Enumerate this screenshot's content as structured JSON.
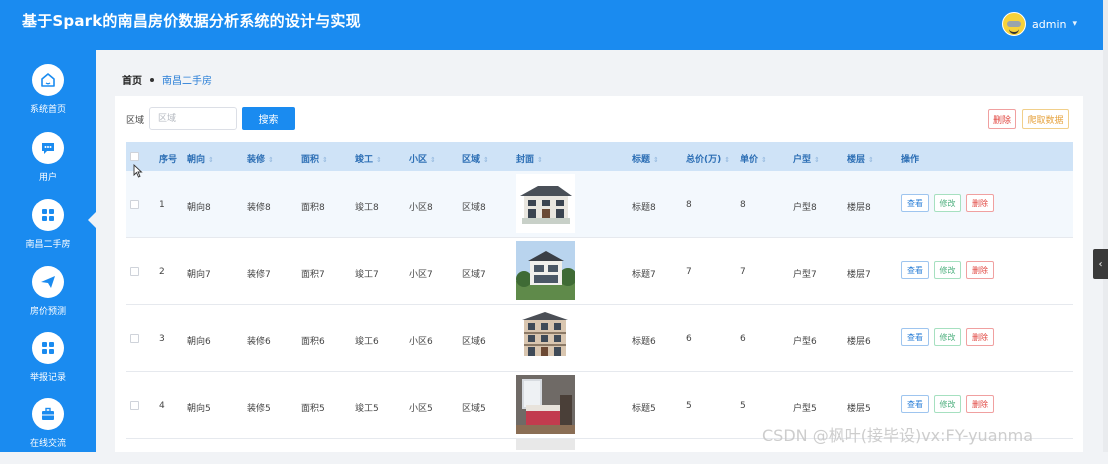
{
  "header": {
    "title": "基于Spark的南昌房价数据分析系统的设计与实现",
    "username": "admin",
    "dropdown_icon": "▾"
  },
  "sidebar": {
    "items": [
      {
        "label": "系统首页",
        "icon": "home-icon"
      },
      {
        "label": "用户",
        "icon": "chat-icon"
      },
      {
        "label": "南昌二手房",
        "icon": "grid-icon",
        "active": true
      },
      {
        "label": "房价预测",
        "icon": "send-icon"
      },
      {
        "label": "举报记录",
        "icon": "grid-icon"
      },
      {
        "label": "在线交流",
        "icon": "briefcase-icon"
      }
    ]
  },
  "breadcrumb": {
    "home": "首页",
    "current": "南昌二手房"
  },
  "search": {
    "label": "区域",
    "placeholder": "区域",
    "button": "搜索"
  },
  "toolbar": {
    "delete": "删除",
    "crawl": "爬取数据"
  },
  "table": {
    "headers": [
      "序号",
      "朝向",
      "装修",
      "面积",
      "竣工",
      "小区",
      "区域",
      "封面",
      "标题",
      "总价(万)",
      "单价",
      "户型",
      "楼层",
      "操作"
    ],
    "rows": [
      {
        "index": "1",
        "orientation": "朝向8",
        "decoration": "装修8",
        "area": "面积8",
        "completed": "竣工8",
        "community": "小区8",
        "region": "区域8",
        "title": "标题8",
        "total": "8",
        "unit_price": "8",
        "layout": "户型8",
        "floor": "楼层8"
      },
      {
        "index": "2",
        "orientation": "朝向7",
        "decoration": "装修7",
        "area": "面积7",
        "completed": "竣工7",
        "community": "小区7",
        "region": "区域7",
        "title": "标题7",
        "total": "7",
        "unit_price": "7",
        "layout": "户型7",
        "floor": "楼层7"
      },
      {
        "index": "3",
        "orientation": "朝向6",
        "decoration": "装修6",
        "area": "面积6",
        "completed": "竣工6",
        "community": "小区6",
        "region": "区域6",
        "title": "标题6",
        "total": "6",
        "unit_price": "6",
        "layout": "户型6",
        "floor": "楼层6"
      },
      {
        "index": "4",
        "orientation": "朝向5",
        "decoration": "装修5",
        "area": "面积5",
        "completed": "竣工5",
        "community": "小区5",
        "region": "区域5",
        "title": "标题5",
        "total": "5",
        "unit_price": "5",
        "layout": "户型5",
        "floor": "楼层5"
      }
    ],
    "actions": {
      "view": "查看",
      "edit": "修改",
      "delete": "删除"
    }
  },
  "watermark": "CSDN @枫叶(接毕设)vx:FY-yuanma",
  "colors": {
    "primary": "#1a8bf0",
    "danger": "#e0443e",
    "warning": "#e6a23c",
    "success": "#4caf7d"
  }
}
